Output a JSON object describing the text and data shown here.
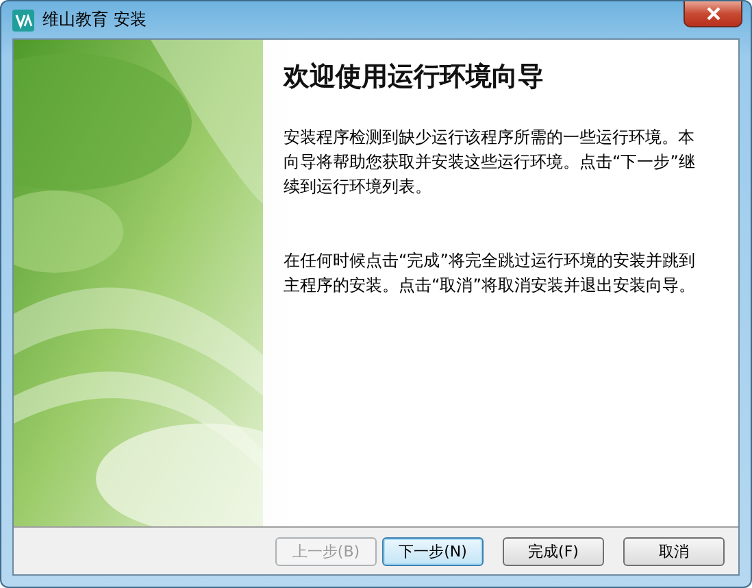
{
  "window": {
    "title": "维山教育 安装"
  },
  "heading": "欢迎使用运行环境向导",
  "paragraphs": [
    "安装程序检测到缺少运行该程序所需的一些运行环境。本向导将帮助您获取并安装这些运行环境。点击“下一步”继续到运行环境列表。",
    "在任何时候点击“完成”将完全跳过运行环境的安装并跳到主程序的安装。点击“取消”将取消安装并退出安装向导。"
  ],
  "buttons": [
    {
      "label": "上一步(B)",
      "disabled": true,
      "default": false
    },
    {
      "label": "下一步(N)",
      "disabled": false,
      "default": true
    },
    {
      "label": "完成(F)",
      "disabled": false,
      "default": false
    },
    {
      "label": "取消",
      "disabled": false,
      "default": false
    }
  ]
}
